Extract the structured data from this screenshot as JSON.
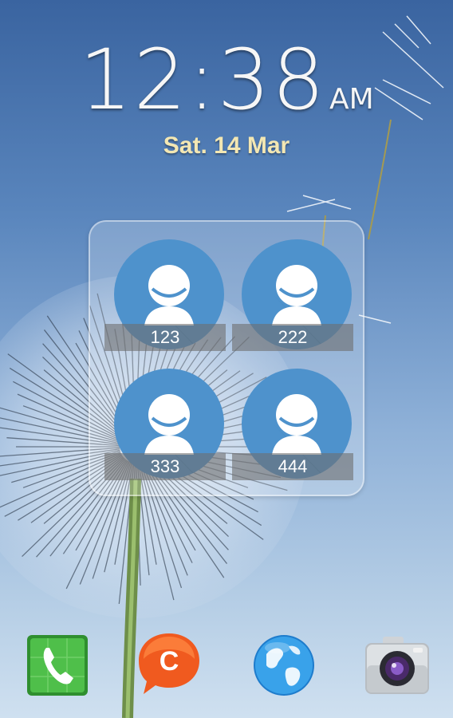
{
  "lockscreen": {
    "time": "12:38",
    "ampm": "AM",
    "date": "Sat. 14 Mar"
  },
  "contacts_widget": {
    "contacts": [
      {
        "label": "123",
        "icon": "person-icon"
      },
      {
        "label": "222",
        "icon": "person-icon"
      },
      {
        "label": "333",
        "icon": "person-icon"
      },
      {
        "label": "444",
        "icon": "person-icon"
      }
    ]
  },
  "dock": {
    "apps": [
      {
        "icon": "phone-icon"
      },
      {
        "icon": "chaton-icon",
        "glyph": "C"
      },
      {
        "icon": "internet-globe-icon"
      },
      {
        "icon": "camera-icon"
      }
    ]
  },
  "colors": {
    "contact_circle": "#4e92cc",
    "date_text": "#f3e7b3",
    "phone_green": "#3aa63a",
    "chaton_orange": "#f06020",
    "globe_blue": "#2b8fd6"
  }
}
